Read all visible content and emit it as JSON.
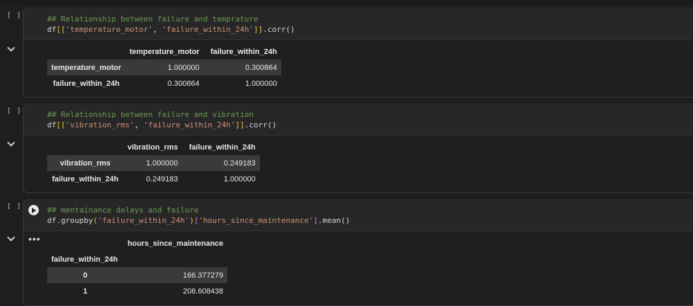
{
  "cells": [
    {
      "bracket": "[ ]",
      "code": {
        "comment": "## Relationship between failure and temprature",
        "line2_prefix": "df",
        "line2_open": "[[",
        "line2_s1": "'temperature_motor'",
        "line2_comma": ", ",
        "line2_s2": "'failure_within_24h'",
        "line2_close": "]]",
        "line2_suffix": ".corr()"
      },
      "table": {
        "columns": [
          "temperature_motor",
          "failure_within_24h"
        ],
        "rows": [
          {
            "index": "temperature_motor",
            "values": [
              "1.000000",
              "0.300864"
            ]
          },
          {
            "index": "failure_within_24h",
            "values": [
              "0.300864",
              "1.000000"
            ]
          }
        ]
      }
    },
    {
      "bracket": "[ ]",
      "code": {
        "comment": "## Relationship between failure and vibration",
        "line2_prefix": "df",
        "line2_open": "[[",
        "line2_s1": "'vibration_rms'",
        "line2_comma": ", ",
        "line2_s2": "'failure_within_24h'",
        "line2_close": "]]",
        "line2_suffix": ".corr()"
      },
      "table": {
        "columns": [
          "vibration_rms",
          "failure_within_24h"
        ],
        "rows": [
          {
            "index": "vibration_rms",
            "values": [
              "1.000000",
              "0.249183"
            ]
          },
          {
            "index": "failure_within_24h",
            "values": [
              "0.249183",
              "1.000000"
            ]
          }
        ]
      }
    },
    {
      "bracket": "[ ]",
      "code": {
        "comment": "## mentainance delays and failure",
        "line2_prefix": "df.groupby",
        "line2_open": "(",
        "line2_s1": "'failure_within_24h'",
        "line2_close1": ")",
        "line2_open2": "[",
        "line2_s2": "'hours_since_maintenance'",
        "line2_close2": "]",
        "line2_suffix": ".mean()"
      },
      "output_dots": "•••",
      "table": {
        "columns": [
          "hours_since_maintenance"
        ],
        "index_name": "failure_within_24h",
        "rows": [
          {
            "index": "0",
            "values": [
              "166.377279"
            ]
          },
          {
            "index": "1",
            "values": [
              "208.608438"
            ]
          }
        ]
      }
    }
  ]
}
